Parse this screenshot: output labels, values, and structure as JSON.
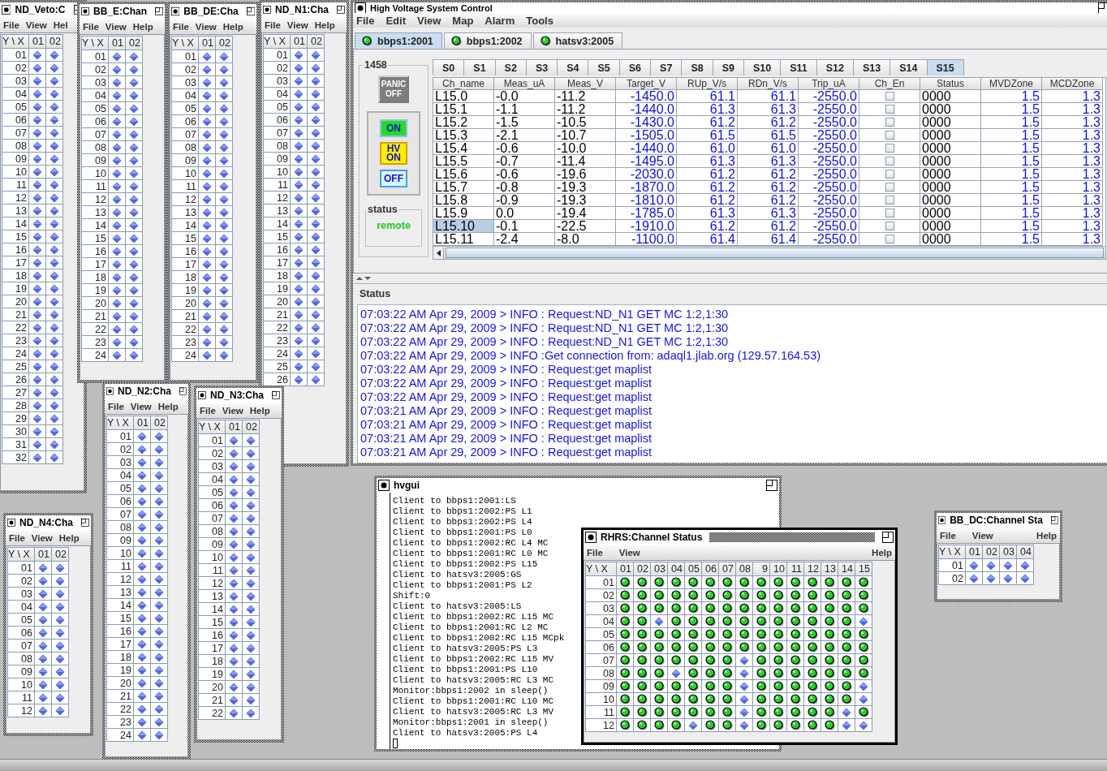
{
  "control_window": {
    "title": "High Voltage System Control",
    "menu": [
      "File",
      "Edit",
      "View",
      "Map",
      "Alarm",
      "Tools"
    ],
    "crate_tabs": [
      {
        "label": "bbps1:2001",
        "connected": true,
        "selected": true
      },
      {
        "label": "bbps1:2002",
        "connected": true,
        "selected": false
      },
      {
        "label": "hatsv3:2005",
        "connected": true,
        "selected": false
      }
    ],
    "crate_group": "1458",
    "buttons": [
      {
        "kind": "panic",
        "lines": [
          "PANIC",
          "OFF"
        ],
        "disabled": true
      },
      {
        "kind": "on",
        "lines": [
          "ON"
        ],
        "disabled": false
      },
      {
        "kind": "hv",
        "lines": [
          "HV",
          "ON"
        ],
        "disabled": false
      },
      {
        "kind": "off",
        "lines": [
          "OFF"
        ],
        "disabled": false
      }
    ],
    "status_group": {
      "label": "status",
      "value": "remote"
    },
    "slot_tabs": [
      {
        "label": "S0",
        "selected": false
      },
      {
        "label": "S1",
        "selected": false
      },
      {
        "label": "S2",
        "selected": false
      },
      {
        "label": "S3",
        "selected": false
      },
      {
        "label": "S4",
        "selected": false
      },
      {
        "label": "S5",
        "selected": false
      },
      {
        "label": "S6",
        "selected": false
      },
      {
        "label": "S7",
        "selected": false
      },
      {
        "label": "S8",
        "selected": false
      },
      {
        "label": "S9",
        "selected": false
      },
      {
        "label": "S10",
        "selected": false
      },
      {
        "label": "S11",
        "selected": false
      },
      {
        "label": "S12",
        "selected": false
      },
      {
        "label": "S13",
        "selected": false
      },
      {
        "label": "S14",
        "selected": false
      },
      {
        "label": "S15",
        "selected": true
      }
    ],
    "table": {
      "columns": [
        {
          "label": "Ch_name",
          "kind": "text"
        },
        {
          "label": "Meas_uA",
          "kind": "text"
        },
        {
          "label": "Meas_V",
          "kind": "text"
        },
        {
          "label": "Target_V",
          "kind": "setting"
        },
        {
          "label": "RUp_V/s",
          "kind": "setting"
        },
        {
          "label": "RDn_V/s",
          "kind": "setting"
        },
        {
          "label": "Trip_uA",
          "kind": "setting"
        },
        {
          "label": "Ch_En",
          "kind": "check"
        },
        {
          "label": "Status",
          "kind": "text"
        },
        {
          "label": "MVDZone",
          "kind": "setting"
        },
        {
          "label": "MCDZone",
          "kind": "setting"
        }
      ],
      "rows": [
        {
          "values": [
            "L15.0",
            "-0.0",
            "-11.2",
            "-1450.0",
            "61.1",
            "61.1",
            "-2550.0",
            "0000",
            "1.5",
            "1.3"
          ],
          "enabled": false,
          "selected": false
        },
        {
          "values": [
            "L15.1",
            "-1.1",
            "-11.2",
            "-1440.0",
            "61.3",
            "61.3",
            "-2550.0",
            "0000",
            "1.5",
            "1.3"
          ],
          "enabled": false,
          "selected": false
        },
        {
          "values": [
            "L15.2",
            "-1.5",
            "-10.5",
            "-1430.0",
            "61.2",
            "61.2",
            "-2550.0",
            "0000",
            "1.5",
            "1.3"
          ],
          "enabled": false,
          "selected": false
        },
        {
          "values": [
            "L15.3",
            "-2.1",
            "-10.7",
            "-1505.0",
            "61.5",
            "61.5",
            "-2550.0",
            "0000",
            "1.5",
            "1.3"
          ],
          "enabled": false,
          "selected": false
        },
        {
          "values": [
            "L15.4",
            "-0.6",
            "-10.0",
            "-1440.0",
            "61.0",
            "61.0",
            "-2550.0",
            "0000",
            "1.5",
            "1.3"
          ],
          "enabled": false,
          "selected": false
        },
        {
          "values": [
            "L15.5",
            "-0.7",
            "-11.4",
            "-1495.0",
            "61.3",
            "61.3",
            "-2550.0",
            "0000",
            "1.5",
            "1.3"
          ],
          "enabled": false,
          "selected": false
        },
        {
          "values": [
            "L15.6",
            "-0.6",
            "-19.6",
            "-2030.0",
            "61.2",
            "61.2",
            "-2550.0",
            "0000",
            "1.5",
            "1.3"
          ],
          "enabled": false,
          "selected": false
        },
        {
          "values": [
            "L15.7",
            "-0.8",
            "-19.3",
            "-1870.0",
            "61.2",
            "61.2",
            "-2550.0",
            "0000",
            "1.5",
            "1.3"
          ],
          "enabled": false,
          "selected": false
        },
        {
          "values": [
            "L15.8",
            "-0.9",
            "-19.3",
            "-1810.0",
            "61.2",
            "61.2",
            "-2550.0",
            "0000",
            "1.5",
            "1.3"
          ],
          "enabled": false,
          "selected": false
        },
        {
          "values": [
            "L15.9",
            "0.0",
            "-19.4",
            "-1785.0",
            "61.3",
            "61.3",
            "-2550.0",
            "0000",
            "1.5",
            "1.3"
          ],
          "enabled": false,
          "selected": false
        },
        {
          "values": [
            "L15.10",
            "-0.1",
            "-22.5",
            "-1910.0",
            "61.2",
            "61.2",
            "-2550.0",
            "0000",
            "1.5",
            "1.3"
          ],
          "enabled": false,
          "selected": true
        },
        {
          "values": [
            "L15.11",
            "-2.4",
            "-8.0",
            "-1100.0",
            "61.4",
            "61.4",
            "-2550.0",
            "0000",
            "1.5",
            "1.3"
          ],
          "enabled": false,
          "selected": false
        }
      ]
    },
    "status_label": "Status",
    "log": [
      "07:03:22 AM Apr 29, 2009 > INFO : Request:ND_N1 GET MC 1:2,1:30",
      "07:03:22 AM Apr 29, 2009 > INFO : Request:ND_N1 GET MC 1:2,1:30",
      "07:03:22 AM Apr 29, 2009 > INFO : Request:ND_N1 GET MC 1:2,1:30",
      "07:03:22 AM Apr 29, 2009 > INFO :Get connection from: adaql1.jlab.org (129.57.164.53)",
      "07:03:22 AM Apr 29, 2009 > INFO : Request:get maplist",
      "07:03:22 AM Apr 29, 2009 > INFO : Request:get maplist",
      "07:03:22 AM Apr 29, 2009 > INFO : Request:get maplist",
      "07:03:21 AM Apr 29, 2009 > INFO : Request:get maplist",
      "07:03:21 AM Apr 29, 2009 > INFO : Request:get maplist",
      "07:03:21 AM Apr 29, 2009 > INFO : Request:get maplist",
      "07:03:21 AM Apr 29, 2009 > INFO : Request:get maplist"
    ]
  },
  "channel_windows": [
    {
      "title": "ND_Veto:C",
      "active": false,
      "menu": [
        "File",
        "View",
        "Hel"
      ],
      "columns": [
        "Y \\ X",
        "01",
        "02"
      ],
      "rows": [
        {
          "label": "01",
          "on": [
            false,
            false
          ]
        },
        {
          "label": "02",
          "on": [
            false,
            false
          ]
        },
        {
          "label": "03",
          "on": [
            false,
            false
          ]
        },
        {
          "label": "04",
          "on": [
            false,
            false
          ]
        },
        {
          "label": "05",
          "on": [
            false,
            false
          ]
        },
        {
          "label": "06",
          "on": [
            false,
            false
          ]
        },
        {
          "label": "07",
          "on": [
            false,
            false
          ]
        },
        {
          "label": "08",
          "on": [
            false,
            false
          ]
        },
        {
          "label": "09",
          "on": [
            false,
            false
          ]
        },
        {
          "label": "10",
          "on": [
            false,
            false
          ]
        },
        {
          "label": "11",
          "on": [
            false,
            false
          ]
        },
        {
          "label": "12",
          "on": [
            false,
            false
          ]
        },
        {
          "label": "13",
          "on": [
            false,
            false
          ]
        },
        {
          "label": "14",
          "on": [
            false,
            false
          ]
        },
        {
          "label": "15",
          "on": [
            false,
            false
          ]
        },
        {
          "label": "16",
          "on": [
            false,
            false
          ]
        },
        {
          "label": "17",
          "on": [
            false,
            false
          ]
        },
        {
          "label": "18",
          "on": [
            false,
            false
          ]
        },
        {
          "label": "19",
          "on": [
            false,
            false
          ]
        },
        {
          "label": "20",
          "on": [
            false,
            false
          ]
        },
        {
          "label": "21",
          "on": [
            false,
            false
          ]
        },
        {
          "label": "22",
          "on": [
            false,
            false
          ]
        },
        {
          "label": "23",
          "on": [
            false,
            false
          ]
        },
        {
          "label": "24",
          "on": [
            false,
            false
          ]
        },
        {
          "label": "25",
          "on": [
            false,
            false
          ]
        },
        {
          "label": "26",
          "on": [
            false,
            false
          ]
        },
        {
          "label": "27",
          "on": [
            false,
            false
          ]
        },
        {
          "label": "28",
          "on": [
            false,
            false
          ]
        },
        {
          "label": "29",
          "on": [
            false,
            false
          ]
        },
        {
          "label": "30",
          "on": [
            false,
            false
          ]
        },
        {
          "label": "31",
          "on": [
            false,
            false
          ]
        },
        {
          "label": "32",
          "on": [
            false,
            false
          ]
        }
      ]
    },
    {
      "title": "BB_E:Chan",
      "active": false,
      "menu": [
        "File",
        "View",
        "Help"
      ],
      "columns": [
        "Y \\ X",
        "01",
        "02"
      ],
      "rows": [
        {
          "label": "01",
          "on": [
            false,
            false
          ]
        },
        {
          "label": "02",
          "on": [
            false,
            false
          ]
        },
        {
          "label": "03",
          "on": [
            false,
            false
          ]
        },
        {
          "label": "04",
          "on": [
            false,
            false
          ]
        },
        {
          "label": "05",
          "on": [
            false,
            false
          ]
        },
        {
          "label": "06",
          "on": [
            false,
            false
          ]
        },
        {
          "label": "07",
          "on": [
            false,
            false
          ]
        },
        {
          "label": "08",
          "on": [
            false,
            false
          ]
        },
        {
          "label": "09",
          "on": [
            false,
            false
          ]
        },
        {
          "label": "10",
          "on": [
            false,
            false
          ]
        },
        {
          "label": "11",
          "on": [
            false,
            false
          ]
        },
        {
          "label": "12",
          "on": [
            false,
            false
          ]
        },
        {
          "label": "13",
          "on": [
            false,
            false
          ]
        },
        {
          "label": "14",
          "on": [
            false,
            false
          ]
        },
        {
          "label": "15",
          "on": [
            false,
            false
          ]
        },
        {
          "label": "16",
          "on": [
            false,
            false
          ]
        },
        {
          "label": "17",
          "on": [
            false,
            false
          ]
        },
        {
          "label": "18",
          "on": [
            false,
            false
          ]
        },
        {
          "label": "19",
          "on": [
            false,
            false
          ]
        },
        {
          "label": "20",
          "on": [
            false,
            false
          ]
        },
        {
          "label": "21",
          "on": [
            false,
            false
          ]
        },
        {
          "label": "22",
          "on": [
            false,
            false
          ]
        },
        {
          "label": "23",
          "on": [
            false,
            false
          ]
        },
        {
          "label": "24",
          "on": [
            false,
            false
          ]
        }
      ]
    },
    {
      "title": "BB_DE:Cha",
      "active": false,
      "menu": [
        "File",
        "View",
        "Help"
      ],
      "columns": [
        "Y \\ X",
        "01",
        "02"
      ],
      "rows": [
        {
          "label": "01",
          "on": [
            false,
            false
          ]
        },
        {
          "label": "02",
          "on": [
            false,
            false
          ]
        },
        {
          "label": "03",
          "on": [
            false,
            false
          ]
        },
        {
          "label": "04",
          "on": [
            false,
            false
          ]
        },
        {
          "label": "05",
          "on": [
            false,
            false
          ]
        },
        {
          "label": "06",
          "on": [
            false,
            false
          ]
        },
        {
          "label": "07",
          "on": [
            false,
            false
          ]
        },
        {
          "label": "08",
          "on": [
            false,
            false
          ]
        },
        {
          "label": "09",
          "on": [
            false,
            false
          ]
        },
        {
          "label": "10",
          "on": [
            false,
            false
          ]
        },
        {
          "label": "11",
          "on": [
            false,
            false
          ]
        },
        {
          "label": "12",
          "on": [
            false,
            false
          ]
        },
        {
          "label": "13",
          "on": [
            false,
            false
          ]
        },
        {
          "label": "14",
          "on": [
            false,
            false
          ]
        },
        {
          "label": "15",
          "on": [
            false,
            false
          ]
        },
        {
          "label": "16",
          "on": [
            false,
            false
          ]
        },
        {
          "label": "17",
          "on": [
            false,
            false
          ]
        },
        {
          "label": "18",
          "on": [
            false,
            false
          ]
        },
        {
          "label": "19",
          "on": [
            false,
            false
          ]
        },
        {
          "label": "20",
          "on": [
            false,
            false
          ]
        },
        {
          "label": "21",
          "on": [
            false,
            false
          ]
        },
        {
          "label": "22",
          "on": [
            false,
            false
          ]
        },
        {
          "label": "23",
          "on": [
            false,
            false
          ]
        },
        {
          "label": "24",
          "on": [
            false,
            false
          ]
        }
      ]
    },
    {
      "title": "ND_N1:Cha",
      "active": false,
      "menu": [
        "File",
        "View",
        "Help"
      ],
      "columns": [
        "Y \\ X",
        "01",
        "02"
      ],
      "rows": [
        {
          "label": "01",
          "on": [
            false,
            false
          ]
        },
        {
          "label": "02",
          "on": [
            false,
            false
          ]
        },
        {
          "label": "03",
          "on": [
            false,
            false
          ]
        },
        {
          "label": "04",
          "on": [
            false,
            false
          ]
        },
        {
          "label": "05",
          "on": [
            false,
            false
          ]
        },
        {
          "label": "06",
          "on": [
            false,
            false
          ]
        },
        {
          "label": "07",
          "on": [
            false,
            false
          ]
        },
        {
          "label": "08",
          "on": [
            false,
            false
          ]
        },
        {
          "label": "09",
          "on": [
            false,
            false
          ]
        },
        {
          "label": "10",
          "on": [
            false,
            false
          ]
        },
        {
          "label": "11",
          "on": [
            false,
            false
          ]
        },
        {
          "label": "12",
          "on": [
            false,
            false
          ]
        },
        {
          "label": "13",
          "on": [
            false,
            false
          ]
        },
        {
          "label": "14",
          "on": [
            false,
            false
          ]
        },
        {
          "label": "15",
          "on": [
            false,
            false
          ]
        },
        {
          "label": "16",
          "on": [
            false,
            false
          ]
        },
        {
          "label": "17",
          "on": [
            false,
            false
          ]
        },
        {
          "label": "18",
          "on": [
            false,
            false
          ]
        },
        {
          "label": "19",
          "on": [
            false,
            false
          ]
        },
        {
          "label": "20",
          "on": [
            false,
            false
          ]
        },
        {
          "label": "21",
          "on": [
            false,
            false
          ]
        },
        {
          "label": "22",
          "on": [
            false,
            false
          ]
        },
        {
          "label": "23",
          "on": [
            false,
            false
          ]
        },
        {
          "label": "24",
          "on": [
            false,
            false
          ]
        },
        {
          "label": "25",
          "on": [
            false,
            false
          ]
        },
        {
          "label": "26",
          "on": [
            false,
            false
          ]
        }
      ]
    },
    {
      "title": "ND_N4:Cha",
      "active": false,
      "menu": [
        "File",
        "View",
        "Help"
      ],
      "columns": [
        "Y \\ X",
        "01",
        "02"
      ],
      "rows": [
        {
          "label": "01",
          "on": [
            false,
            false
          ]
        },
        {
          "label": "02",
          "on": [
            false,
            false
          ]
        },
        {
          "label": "03",
          "on": [
            false,
            false
          ]
        },
        {
          "label": "04",
          "on": [
            false,
            false
          ]
        },
        {
          "label": "05",
          "on": [
            false,
            false
          ]
        },
        {
          "label": "06",
          "on": [
            false,
            false
          ]
        },
        {
          "label": "07",
          "on": [
            false,
            false
          ]
        },
        {
          "label": "08",
          "on": [
            false,
            false
          ]
        },
        {
          "label": "09",
          "on": [
            false,
            false
          ]
        },
        {
          "label": "10",
          "on": [
            false,
            false
          ]
        },
        {
          "label": "11",
          "on": [
            false,
            false
          ]
        },
        {
          "label": "12",
          "on": [
            false,
            false
          ]
        }
      ]
    },
    {
      "title": "ND_N2:Cha",
      "active": false,
      "menu": [
        "File",
        "View",
        "Help"
      ],
      "columns": [
        "Y \\ X",
        "01",
        "02"
      ],
      "rows": [
        {
          "label": "01",
          "on": [
            false,
            false
          ]
        },
        {
          "label": "02",
          "on": [
            false,
            false
          ]
        },
        {
          "label": "03",
          "on": [
            false,
            false
          ]
        },
        {
          "label": "04",
          "on": [
            false,
            false
          ]
        },
        {
          "label": "05",
          "on": [
            false,
            false
          ]
        },
        {
          "label": "06",
          "on": [
            false,
            false
          ]
        },
        {
          "label": "07",
          "on": [
            false,
            false
          ]
        },
        {
          "label": "08",
          "on": [
            false,
            false
          ]
        },
        {
          "label": "09",
          "on": [
            false,
            false
          ]
        },
        {
          "label": "10",
          "on": [
            false,
            false
          ]
        },
        {
          "label": "11",
          "on": [
            false,
            false
          ]
        },
        {
          "label": "12",
          "on": [
            false,
            false
          ]
        },
        {
          "label": "13",
          "on": [
            false,
            false
          ]
        },
        {
          "label": "14",
          "on": [
            false,
            false
          ]
        },
        {
          "label": "15",
          "on": [
            false,
            false
          ]
        },
        {
          "label": "16",
          "on": [
            false,
            false
          ]
        },
        {
          "label": "17",
          "on": [
            false,
            false
          ]
        },
        {
          "label": "18",
          "on": [
            false,
            false
          ]
        },
        {
          "label": "19",
          "on": [
            false,
            false
          ]
        },
        {
          "label": "20",
          "on": [
            false,
            false
          ]
        },
        {
          "label": "21",
          "on": [
            false,
            false
          ]
        },
        {
          "label": "22",
          "on": [
            false,
            false
          ]
        },
        {
          "label": "23",
          "on": [
            false,
            false
          ]
        },
        {
          "label": "24",
          "on": [
            false,
            false
          ]
        }
      ]
    },
    {
      "title": "ND_N3:Cha",
      "active": false,
      "menu": [
        "File",
        "View",
        "Help"
      ],
      "columns": [
        "Y \\ X",
        "01",
        "02"
      ],
      "rows": [
        {
          "label": "01",
          "on": [
            false,
            false
          ]
        },
        {
          "label": "02",
          "on": [
            false,
            false
          ]
        },
        {
          "label": "03",
          "on": [
            false,
            false
          ]
        },
        {
          "label": "04",
          "on": [
            false,
            false
          ]
        },
        {
          "label": "05",
          "on": [
            false,
            false
          ]
        },
        {
          "label": "06",
          "on": [
            false,
            false
          ]
        },
        {
          "label": "07",
          "on": [
            false,
            false
          ]
        },
        {
          "label": "08",
          "on": [
            false,
            false
          ]
        },
        {
          "label": "09",
          "on": [
            false,
            false
          ]
        },
        {
          "label": "10",
          "on": [
            false,
            false
          ]
        },
        {
          "label": "11",
          "on": [
            false,
            false
          ]
        },
        {
          "label": "12",
          "on": [
            false,
            false
          ]
        },
        {
          "label": "13",
          "on": [
            false,
            false
          ]
        },
        {
          "label": "14",
          "on": [
            false,
            false
          ]
        },
        {
          "label": "15",
          "on": [
            false,
            false
          ]
        },
        {
          "label": "16",
          "on": [
            false,
            false
          ]
        },
        {
          "label": "17",
          "on": [
            false,
            false
          ]
        },
        {
          "label": "18",
          "on": [
            false,
            false
          ]
        },
        {
          "label": "19",
          "on": [
            false,
            false
          ]
        },
        {
          "label": "20",
          "on": [
            false,
            false
          ]
        },
        {
          "label": "21",
          "on": [
            false,
            false
          ]
        },
        {
          "label": "22",
          "on": [
            false,
            false
          ]
        }
      ]
    },
    {
      "title": "RHRS:Channel Status",
      "active": true,
      "menu": [
        "File",
        "View",
        "Help"
      ],
      "columns": [
        "Y \\ X",
        "01",
        "02",
        "03",
        "04",
        "05",
        "06",
        "07",
        "08",
        "9",
        "10",
        "11",
        "12",
        "13",
        "14",
        "15"
      ],
      "rows": [
        {
          "label": "01",
          "on": [
            true,
            true,
            true,
            true,
            true,
            true,
            true,
            true,
            true,
            true,
            true,
            true,
            true,
            true,
            true
          ]
        },
        {
          "label": "02",
          "on": [
            true,
            true,
            true,
            true,
            true,
            true,
            true,
            true,
            true,
            true,
            true,
            true,
            true,
            true,
            true
          ]
        },
        {
          "label": "03",
          "on": [
            true,
            true,
            true,
            true,
            true,
            true,
            true,
            true,
            true,
            true,
            true,
            true,
            true,
            true,
            true
          ]
        },
        {
          "label": "04",
          "on": [
            true,
            true,
            false,
            true,
            true,
            true,
            true,
            true,
            true,
            true,
            true,
            true,
            true,
            true,
            false
          ]
        },
        {
          "label": "05",
          "on": [
            true,
            true,
            true,
            true,
            true,
            true,
            true,
            true,
            true,
            true,
            true,
            true,
            true,
            true,
            true
          ]
        },
        {
          "label": "06",
          "on": [
            true,
            true,
            true,
            true,
            true,
            true,
            true,
            true,
            true,
            true,
            true,
            true,
            true,
            true,
            true
          ]
        },
        {
          "label": "07",
          "on": [
            true,
            true,
            true,
            true,
            true,
            true,
            true,
            false,
            true,
            true,
            true,
            true,
            true,
            true,
            true
          ]
        },
        {
          "label": "08",
          "on": [
            true,
            true,
            true,
            false,
            true,
            true,
            true,
            false,
            true,
            true,
            true,
            true,
            true,
            true,
            true
          ]
        },
        {
          "label": "09",
          "on": [
            true,
            true,
            true,
            true,
            true,
            true,
            true,
            false,
            true,
            true,
            true,
            true,
            true,
            true,
            false
          ]
        },
        {
          "label": "10",
          "on": [
            true,
            true,
            true,
            true,
            true,
            true,
            true,
            false,
            true,
            true,
            true,
            true,
            true,
            true,
            false
          ]
        },
        {
          "label": "11",
          "on": [
            true,
            true,
            true,
            true,
            true,
            true,
            true,
            false,
            true,
            true,
            true,
            true,
            true,
            false,
            true
          ]
        },
        {
          "label": "12",
          "on": [
            true,
            true,
            true,
            true,
            false,
            true,
            true,
            false,
            true,
            true,
            true,
            true,
            true,
            false,
            false
          ]
        }
      ]
    },
    {
      "title": "BB_DC:Channel Sta",
      "active": false,
      "menu": [
        "File",
        "View",
        "Help"
      ],
      "columns": [
        "Y \\ X",
        "01",
        "02",
        "03",
        "04"
      ],
      "rows": [
        {
          "label": "01",
          "on": [
            false,
            false,
            false,
            false
          ]
        },
        {
          "label": "02",
          "on": [
            false,
            false,
            false,
            false
          ]
        }
      ]
    }
  ],
  "console_window": {
    "title": "hvgui",
    "lines": [
      "Client to bbps1:2001:LS",
      "Client to bbps1:2002:PS L1",
      "Client to bbps1:2002:PS L4",
      "Client to bbps1:2001:PS L0",
      "Client to bbps1:2002:RC L4 MC",
      "Client to bbps1:2001:RC L0 MC",
      "Client to bbps1:2002:PS L15",
      "Client to hatsv3:2005:GS",
      "Client to bbps1:2001:PS L2",
      "Shift:0",
      "Client to hatsv3:2005:LS",
      "Client to bbps1:2002:RC L15 MC",
      "Client to bbps1:2001:RC L2 MC",
      "Client to bbps1:2002:RC L15 MCpk",
      "Client to hatsv3:2005:PS L3",
      "Client to bbps1:2002:RC L15 MV",
      "Client to bbps1:2001:PS L10",
      "Client to hatsv3:2005:RC L3 MC",
      "Monitor:bbps1:2002 in sleep()",
      "Client to bbps1:2001:RC L10 MC",
      "Client to hatsv3:2005:RC L3 MV",
      "Monitor:bbps1:2001 in sleep()",
      "Client to hatsv3:2005:PS L4"
    ]
  }
}
